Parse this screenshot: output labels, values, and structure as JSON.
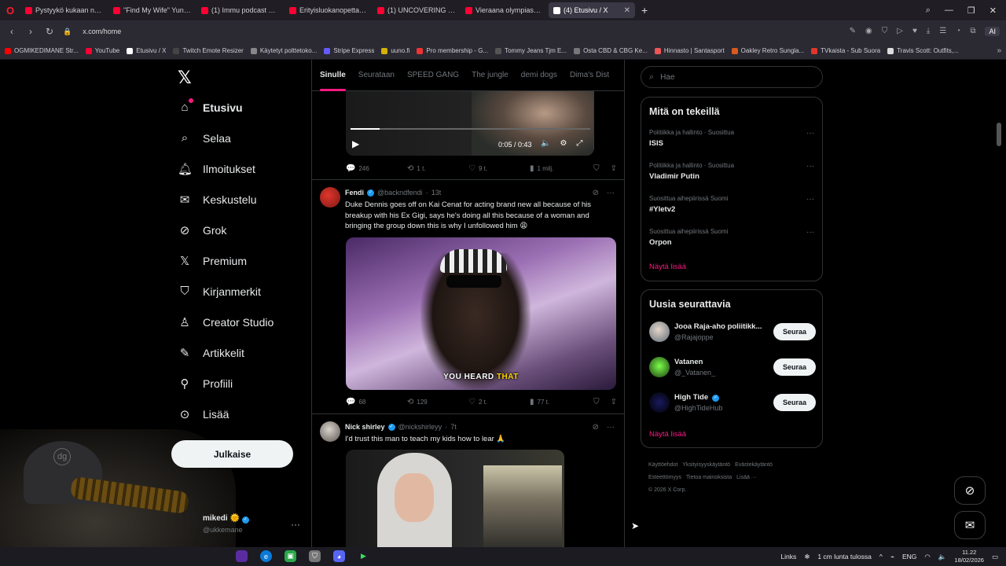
{
  "browser": {
    "tabs": [
      {
        "label": "Pystyykö kukaan nostama",
        "active": false
      },
      {
        "label": "\"Find My Wife\" Yuno Mila",
        "active": false
      },
      {
        "label": "(1) Immu podcast Podim",
        "active": false
      },
      {
        "label": "Erityisluokanopettajan ark",
        "active": false
      },
      {
        "label": "(1) UNCOVERING DARK E",
        "active": false
      },
      {
        "label": "Vieraana olympiasankari A",
        "active": false
      },
      {
        "label": "(4) Etusivu / X",
        "active": true
      }
    ],
    "url": "x.com/home",
    "ai_label": "AI",
    "bookmarks": [
      "OGMIKEDIMANE Str...",
      "YouTube",
      "Etusivu / X",
      "Twitch Emote Resizer",
      "Käytetyt polttetoko...",
      "Stripe Express",
      "uuno.fi",
      "Pro membership - G...",
      "Tommy Jeans Tjm E...",
      "Osta CBD & CBG Ke...",
      "Hinnasto | Santasport",
      "Oakley Retro Sungla...",
      "TVkaista - Sub Suora",
      "Travis Scott: Outfits,..."
    ]
  },
  "sidebar": {
    "items": [
      {
        "label": "Etusivu",
        "icon": "home-icon"
      },
      {
        "label": "Selaa",
        "icon": "search-icon"
      },
      {
        "label": "Ilmoitukset",
        "icon": "bell-icon"
      },
      {
        "label": "Keskustelu",
        "icon": "mail-icon"
      },
      {
        "label": "Grok",
        "icon": "grok-icon"
      },
      {
        "label": "Premium",
        "icon": "x-icon"
      },
      {
        "label": "Kirjanmerkit",
        "icon": "bookmark-icon"
      },
      {
        "label": "Creator Studio",
        "icon": "creator-icon"
      },
      {
        "label": "Artikkelit",
        "icon": "article-icon"
      },
      {
        "label": "Profiili",
        "icon": "person-icon"
      },
      {
        "label": "Lisää",
        "icon": "more-icon"
      }
    ],
    "post_button": "Julkaise",
    "profile": {
      "name": "mikedi",
      "handle": "@ukkemane"
    }
  },
  "feed": {
    "tabs": [
      "Sinulle",
      "Seurataan",
      "SPEED GANG",
      "The jungle",
      "demi dogs",
      "Dima's Dist"
    ],
    "tweets": [
      {
        "video": {
          "time": "0:05 / 0:43",
          "progress": 0.12
        },
        "replies": "246",
        "reposts": "1 t.",
        "likes": "9 t.",
        "views": "1 milj."
      },
      {
        "name": "Fendi",
        "handle": "@backndfendi",
        "time": "13t",
        "text": "Duke Dennis goes off on Kai Cenat for acting brand new all because of his breakup with his Ex Gigi, says he's doing all this because of a woman and bringing the group down this is why I unfollowed him 😩",
        "caption_main": "YOU HEARD",
        "caption_hl": "THAT",
        "replies": "68",
        "reposts": "129",
        "likes": "2 t.",
        "views": "77 t."
      },
      {
        "name": "Nick shirley",
        "handle": "@nickshirleyy",
        "time": "7t",
        "text": "I'd trust this man to teach my kids how to lear 🙏"
      }
    ]
  },
  "right": {
    "search_placeholder": "Hae",
    "trending": {
      "title": "Mitä on tekeillä",
      "items": [
        {
          "category": "Politiikka ja hallinto · Suosittua",
          "name": "ISIS"
        },
        {
          "category": "Politiikka ja hallinto · Suosittua",
          "name": "Vladimir Putin"
        },
        {
          "category": "Suosittua aihepiirissä Suomi",
          "name": "#Yletv2"
        },
        {
          "category": "Suosittua aihepiirissä Suomi",
          "name": "Orpon"
        }
      ],
      "show_more": "Näytä lisää"
    },
    "who_to_follow": {
      "title": "Uusia seurattavia",
      "items": [
        {
          "name": "Jooa Raja-aho poliitikk...",
          "handle": "@Rajajoppe",
          "button": "Seuraa"
        },
        {
          "name": "Vatanen",
          "handle": "@_Vatanen_",
          "button": "Seuraa"
        },
        {
          "name": "High Tide",
          "handle": "@HighTideHub",
          "button": "Seuraa"
        }
      ],
      "show_more": "Näytä lisää"
    },
    "footer": [
      "Käyttöehdot",
      "Yksityisyyskäytäntö",
      "Evästekäytäntö",
      "Esteettömyys",
      "Tietoa mainoksista",
      "Lisää ···",
      "© 2026 X Corp."
    ]
  },
  "taskbar": {
    "links_label": "Links",
    "weather": "1 cm lunta tulossa",
    "lang": "ENG",
    "time": "11.22",
    "date": "18/02/2026"
  },
  "colors": {
    "accent": "#f91880",
    "verified": "#1d9bf0",
    "background": "#000000"
  }
}
